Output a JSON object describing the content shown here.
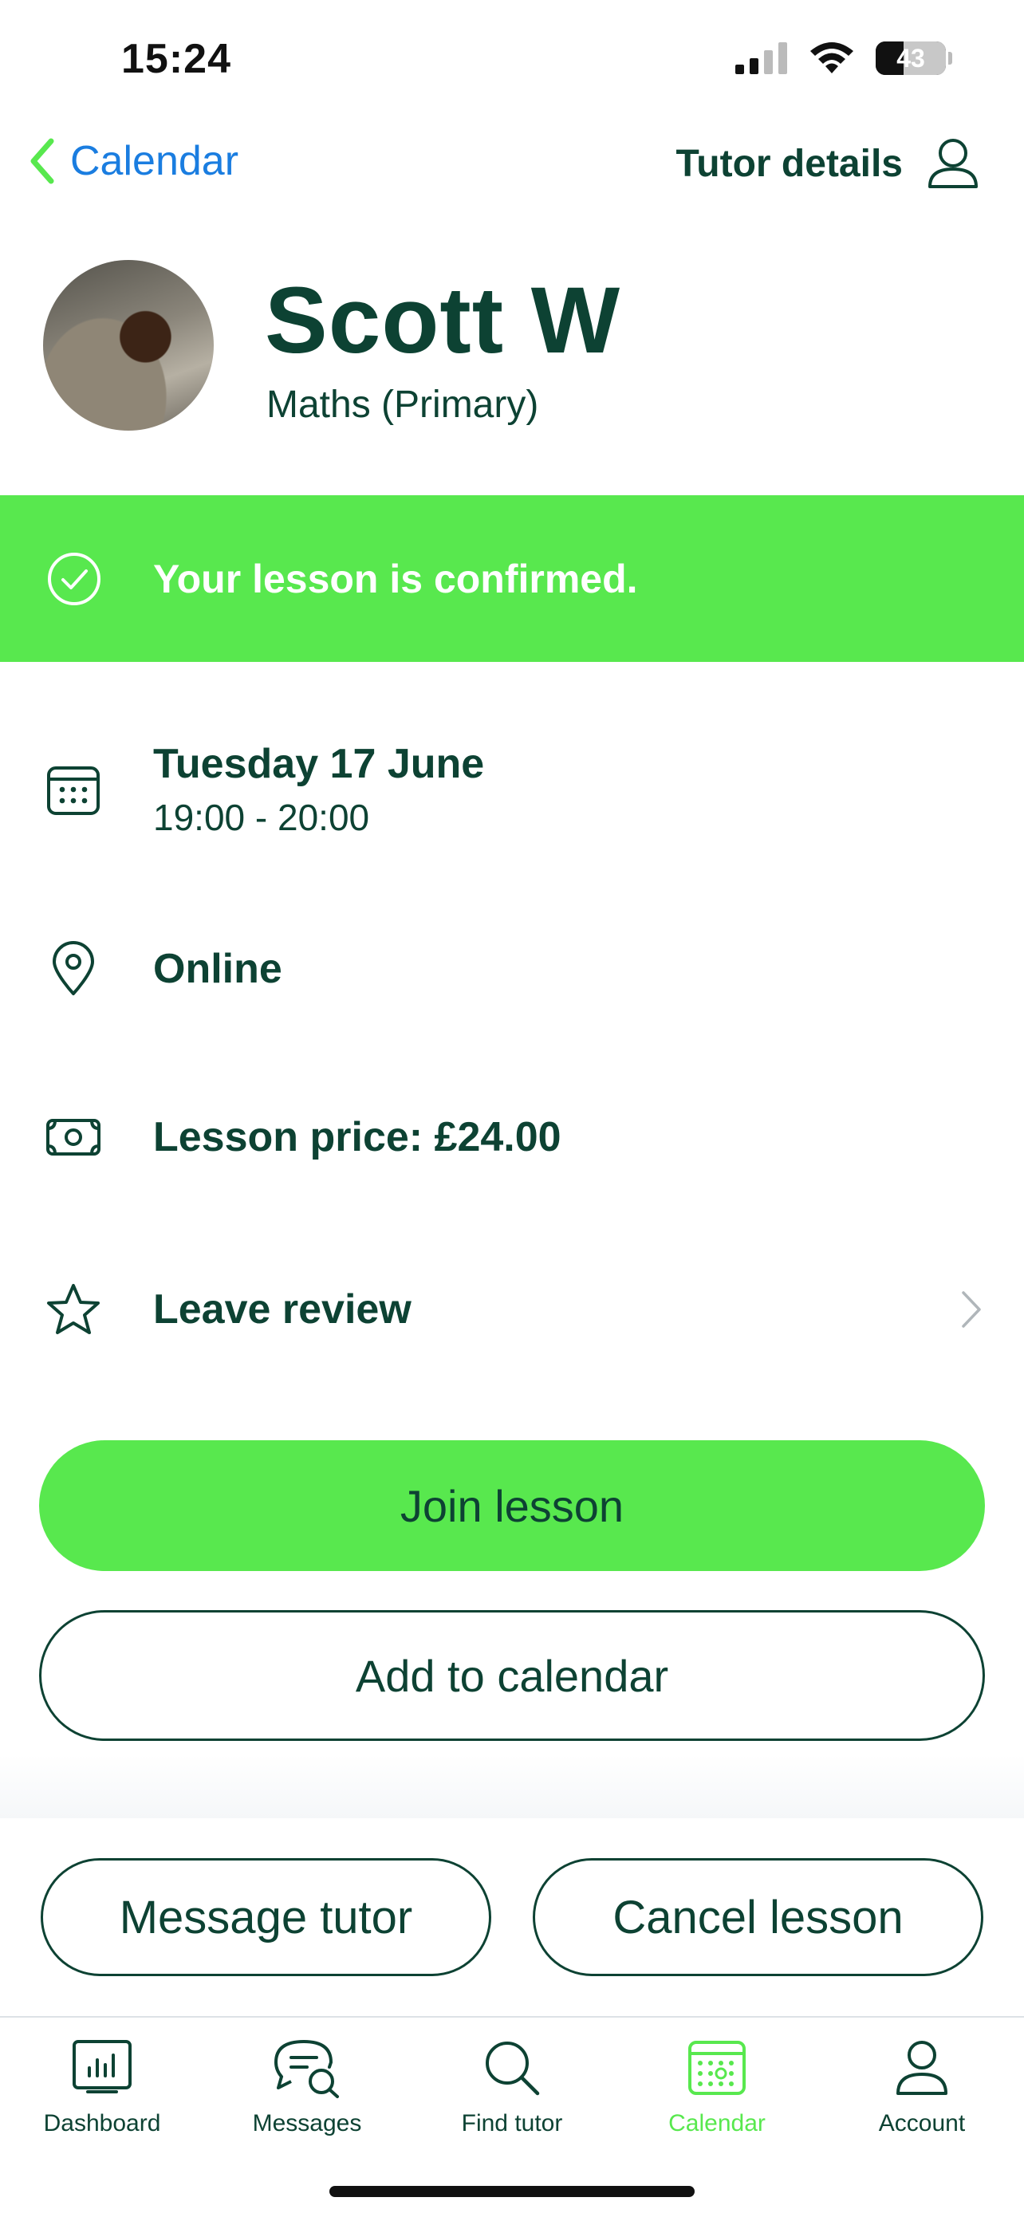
{
  "status_bar": {
    "time": "15:24",
    "battery": "43"
  },
  "nav": {
    "back_label": "Calendar",
    "tutor_details_label": "Tutor details"
  },
  "tutor": {
    "name": "Scott W",
    "subject": "Maths (Primary)"
  },
  "banner": {
    "text": "Your lesson is confirmed.",
    "color": "#58e84e"
  },
  "details": {
    "date": "Tuesday 17 June",
    "time": "19:00 - 20:00",
    "location": "Online",
    "price": "Lesson price: £24.00",
    "review": "Leave review"
  },
  "actions": {
    "join": "Join lesson",
    "add_calendar": "Add to calendar",
    "message_tutor": "Message tutor",
    "cancel_lesson": "Cancel lesson"
  },
  "tabs": [
    {
      "label": "Dashboard",
      "icon": "dashboard-icon"
    },
    {
      "label": "Messages",
      "icon": "messages-icon"
    },
    {
      "label": "Find tutor",
      "icon": "search-icon"
    },
    {
      "label": "Calendar",
      "icon": "calendar-icon",
      "active": true
    },
    {
      "label": "Account",
      "icon": "account-icon"
    }
  ],
  "colors": {
    "primary_text": "#0d4233",
    "accent_green": "#58e84e",
    "link_blue": "#1a7de0"
  }
}
